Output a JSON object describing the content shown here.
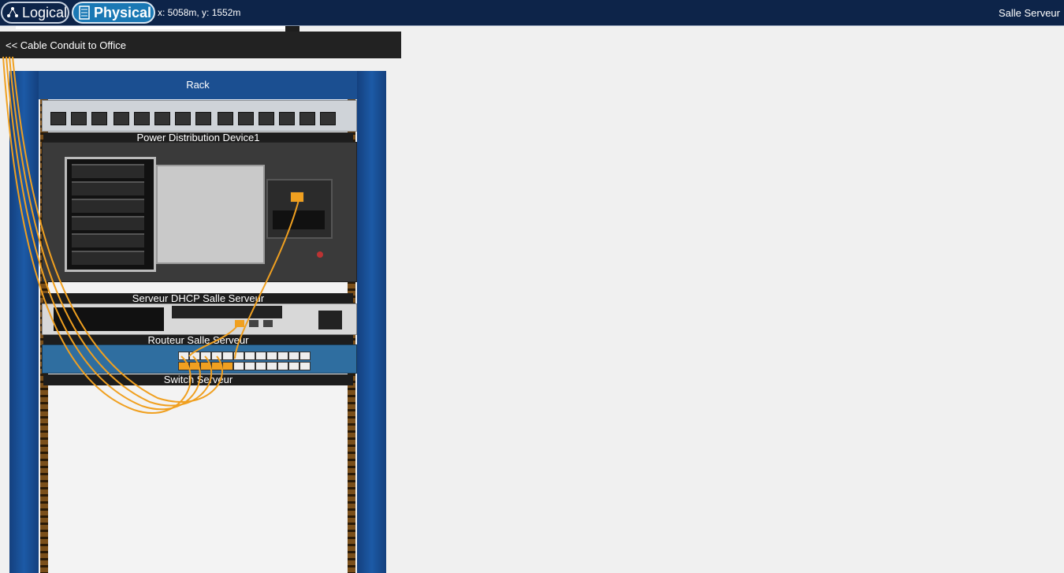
{
  "toolbar": {
    "logical_label": "Logical",
    "physical_label": "Physical",
    "coords": "x: 5058m, y: 1552m",
    "location": "Salle Serveur"
  },
  "nav": {
    "back_label": "<< Cable Conduit to Office"
  },
  "rack": {
    "title": "Rack",
    "devices": [
      {
        "label": "Power Distribution Device1"
      },
      {
        "label": "Serveur DHCP Salle Serveur"
      },
      {
        "label": "Routeur Salle Serveur"
      },
      {
        "label": "Switch Serveur"
      }
    ]
  },
  "colors": {
    "topbar": "#0d2449",
    "physical_tab": "#1a78b4",
    "rack_post": "#1c5aa6",
    "cable": "#f0a020"
  }
}
